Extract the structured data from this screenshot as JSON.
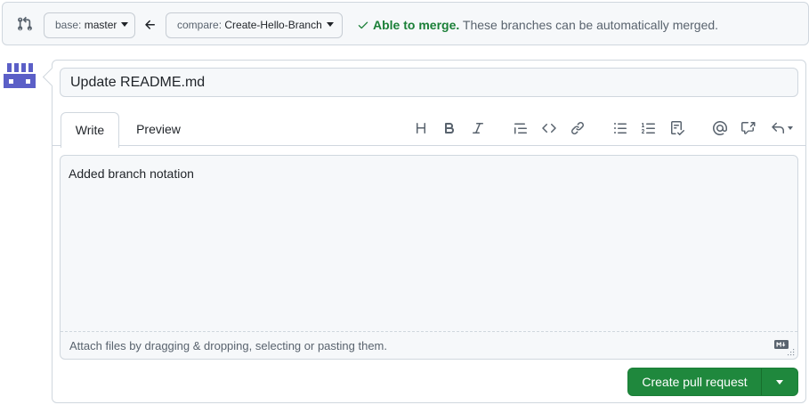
{
  "compare_bar": {
    "base": {
      "prefix": "base:",
      "branch": "master"
    },
    "compare": {
      "prefix": "compare:",
      "branch": "Create-Hello-Branch"
    },
    "status_ok": "Able to merge.",
    "status_message": "These branches can be automatically merged."
  },
  "form": {
    "title_value": "Update README.md",
    "tabs": {
      "write": "Write",
      "preview": "Preview"
    },
    "toolbar_icons": [
      "heading-icon",
      "bold-icon",
      "italic-icon",
      "quote-icon",
      "code-icon",
      "link-icon",
      "unordered-list-icon",
      "ordered-list-icon",
      "task-list-icon",
      "mention-icon",
      "reference-icon",
      "reply-icon"
    ],
    "body_value": "Added branch notation",
    "attach_hint": "Attach files by dragging & dropping, selecting or pasting them.",
    "submit_label": "Create pull request"
  },
  "colors": {
    "accent_green": "#1f883d",
    "merge_ok": "#1a7f37"
  }
}
